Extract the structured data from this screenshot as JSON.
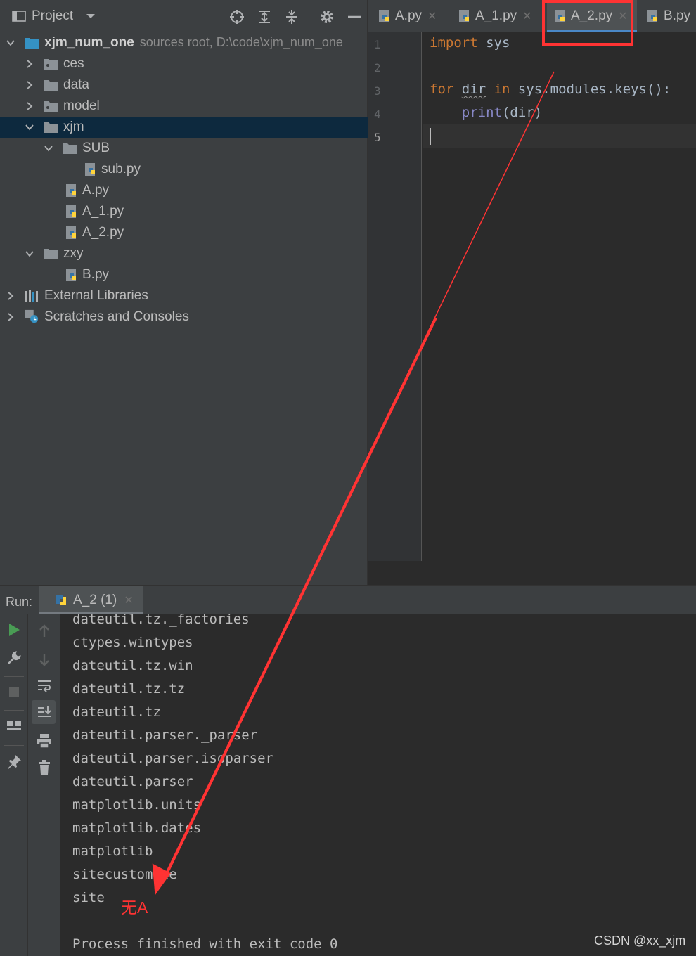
{
  "project": {
    "title": "Project",
    "tree": [
      {
        "label": "xjm_num_one",
        "hint": "sources root,  D:\\code\\xjm_num_one",
        "level": 0,
        "expanded": true,
        "icon": "module-folder-icon"
      },
      {
        "label": "ces",
        "level": 1,
        "expanded": false,
        "icon": "package-folder-icon"
      },
      {
        "label": "data",
        "level": 1,
        "expanded": false,
        "icon": "folder-icon"
      },
      {
        "label": "model",
        "level": 1,
        "expanded": false,
        "icon": "package-folder-icon"
      },
      {
        "label": "xjm",
        "level": 1,
        "expanded": true,
        "icon": "folder-icon",
        "selected": true
      },
      {
        "label": "SUB",
        "level": 2,
        "expanded": true,
        "icon": "folder-icon"
      },
      {
        "label": "sub.py",
        "level": 3,
        "icon": "python-file-icon"
      },
      {
        "label": "A.py",
        "level": 2,
        "icon": "python-file-icon"
      },
      {
        "label": "A_1.py",
        "level": 2,
        "icon": "python-file-icon"
      },
      {
        "label": "A_2.py",
        "level": 2,
        "icon": "python-file-icon"
      },
      {
        "label": "zxy",
        "level": 1,
        "expanded": true,
        "icon": "folder-icon"
      },
      {
        "label": "B.py",
        "level": 2,
        "icon": "python-file-icon"
      },
      {
        "label": "External Libraries",
        "level": 0,
        "expanded": false,
        "icon": "libraries-icon"
      },
      {
        "label": "Scratches and Consoles",
        "level": 0,
        "expanded": false,
        "icon": "scratches-icon"
      }
    ]
  },
  "editor": {
    "tabs": [
      {
        "label": "A.py",
        "active": false
      },
      {
        "label": "A_1.py",
        "active": false
      },
      {
        "label": "A_2.py",
        "active": true
      },
      {
        "label": "B.py",
        "active": false
      }
    ],
    "line_numbers": [
      "1",
      "2",
      "3",
      "4",
      "5"
    ],
    "code": {
      "l1_kw": "import",
      "l1_rest": " sys",
      "l3_kw1": "for",
      "l3_var": "dir",
      "l3_kw2": "in",
      "l3_rest": " sys.modules.keys():",
      "l4_indent": "    ",
      "l4_fn": "print",
      "l4_rest": "(dir)"
    }
  },
  "run": {
    "label": "Run:",
    "tab": "A_2 (1)",
    "output": [
      "dateutil.tz._factories",
      "ctypes.wintypes",
      "dateutil.tz.win",
      "dateutil.tz.tz",
      "dateutil.tz",
      "dateutil.parser._parser",
      "dateutil.parser.isoparser",
      "dateutil.parser",
      "matplotlib.units",
      "matplotlib.dates",
      "matplotlib",
      "sitecustomize",
      "site",
      "",
      "Process finished with exit code 0"
    ]
  },
  "annotation": {
    "note": "无A",
    "color": "#ff3333"
  },
  "watermark": "CSDN @xx_xjm",
  "colors": {
    "keyword": "#cc7832",
    "builtin": "#8888c6",
    "text": "#a9b7c6",
    "run_green": "#499c54"
  }
}
